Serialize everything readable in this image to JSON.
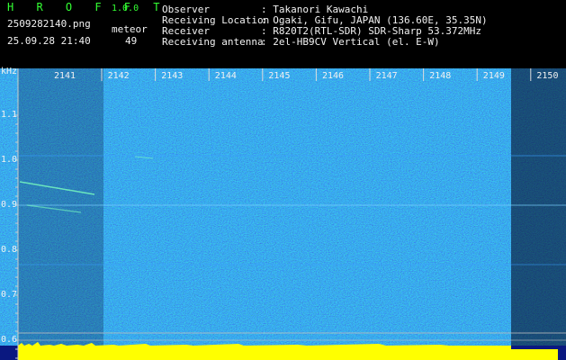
{
  "header": {
    "app_title": "H R O F F T",
    "version": "1.0.0",
    "filename": "2509282140.png",
    "mode": "meteor",
    "datetime": "25.09.28 21:40",
    "count": "49"
  },
  "info": [
    {
      "label": "Observer",
      "value": ": Takanori Kawachi"
    },
    {
      "label": "Receiving Location",
      "value": ": Ogaki, Gifu, JAPAN (136.60E, 35.35N)"
    },
    {
      "label": "Receiver",
      "value": ": R820T2(RTL-SDR) SDR-Sharp 53.372MHz"
    },
    {
      "label": "Receiving antenna",
      "value": ": 2el-HB9CV Vertical (el. E-W)"
    }
  ],
  "axis": {
    "y_unit": "kHz",
    "y_ticks": [
      "1.1",
      "1.0",
      "0.9",
      "0.8",
      "0.7",
      "0.6"
    ],
    "x_ticks": [
      "2141",
      "2142",
      "2143",
      "2144",
      "2145",
      "2146",
      "2147",
      "2148",
      "2149",
      "2150"
    ]
  },
  "colors": {
    "background": "#000000",
    "spectrum_base": "#0a1880",
    "header_green": "#33ff33",
    "header_white": "#f2f2f2",
    "baseline_yellow": "#ffff00"
  }
}
